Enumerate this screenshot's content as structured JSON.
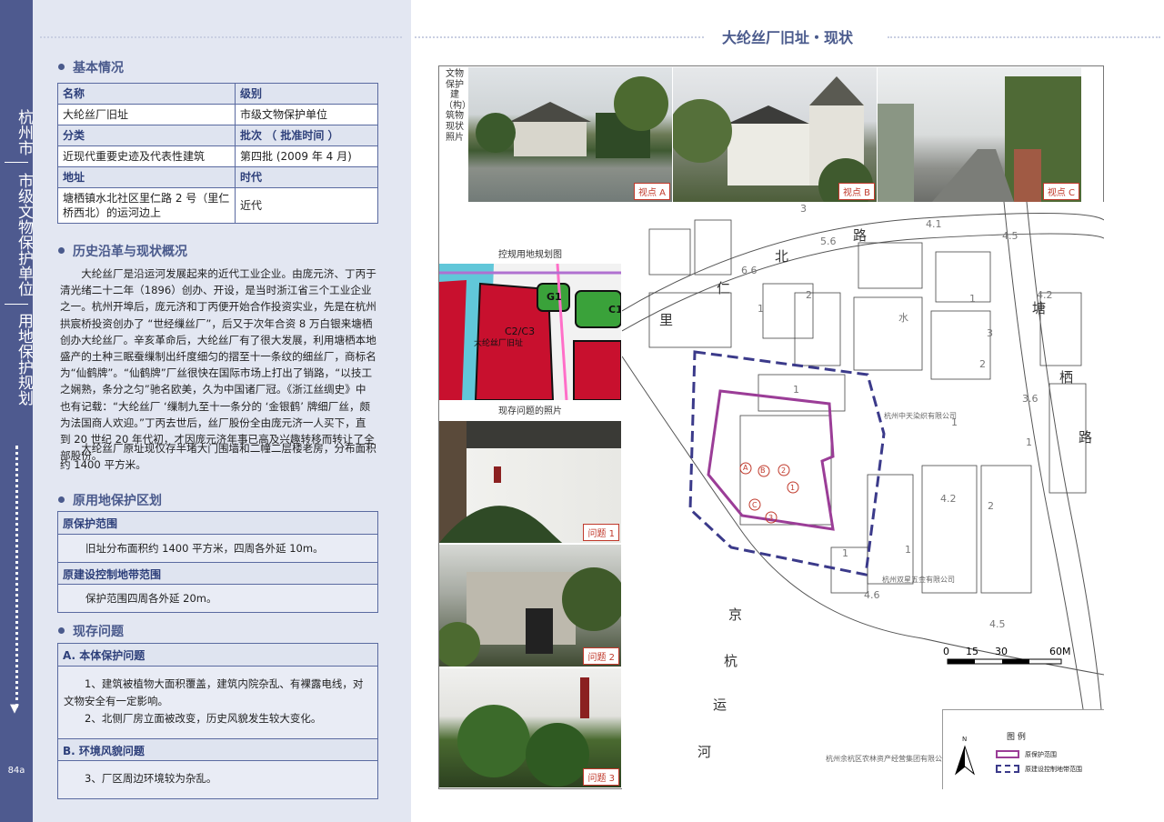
{
  "sidebar": {
    "city": "杭州市",
    "level": "市级文物保护单位",
    "plan": "用地保护规划",
    "page_no": "84a"
  },
  "page_title": "大纶丝厂旧址・现状",
  "sections": {
    "basic": "基本情况",
    "history": "历史沿革与现状概况",
    "protection": "原用地保护区划",
    "issues": "现存问题"
  },
  "basic_table": {
    "name_h": "名称",
    "name_v": "大纶丝厂旧址",
    "level_h": "级别",
    "level_v": "市级文物保护单位",
    "cat_h": "分类",
    "cat_v": "近现代重要史迹及代表性建筑",
    "batch_h": "批次 （ 批准时间 ）",
    "batch_v": "第四批 (2009 年 4 月)",
    "addr_h": "地址",
    "addr_v": "塘栖镇水北社区里仁路 2 号（里仁桥西北）的运河边上",
    "era_h": "时代",
    "era_v": "近代"
  },
  "history_text": "大纶丝厂是沿运河发展起来的近代工业企业。由庞元济、丁丙于清光绪二十二年（1896）创办、开设，是当时浙江省三个工业企业之一。杭州开埠后，庞元济和丁丙便开始合作投资实业，先是在杭州拱宸桥投资创办了 “世经缫丝厂”，后又于次年合资 8 万白银来塘栖创办大纶丝厂。辛亥革命后，大纶丝厂有了很大发展，利用塘栖本地盛产的土种三眠蚕缫制出纤度细匀的摺至十一条纹的细丝厂，商标名为“仙鹤牌”。“仙鹤牌”厂丝很快在国际市场上打出了销路，“以技工之娴熟，条分之匀”驰名欧美，久为中国诸厂冠。《浙江丝绸史》中也有记载：“大纶丝厂 ‘缫制九至十一条分的 ‘金银鹤’ 牌细厂丝，颇为法国商人欢迎。”丁丙去世后，丝厂股份全由庞元济一人买下，直到 20 世纪 20 年代初，才因庞元济年事已高及兴趣转移而转让了全部股份。",
  "history_text2": "大纶丝厂原址现仅存半堵大门围墙和二幢二层楼老房，分布面积约 1400 平方米。",
  "protection": {
    "range_h": "原保护范围",
    "range_v": "旧址分布面积约 1400 平方米，四周各外延 10m。",
    "ctrl_h": "原建设控制地带范围",
    "ctrl_v": "保护范围四周各外延 20m。"
  },
  "issues": {
    "a_h": "A. 本体保护问题",
    "a_v1": "1、建筑被植物大面积覆盖，建筑内院杂乱、有裸露电线，对文物安全有一定影响。",
    "a_v2": "2、北侧厂房立面被改变，历史风貌发生较大变化。",
    "b_h": "B. 环境风貌问题",
    "b_v": "3、厂区周边环境较为杂乱。"
  },
  "map": {
    "photo_caption": "文物保护建（构）筑物现状照片",
    "viewpoints": [
      "视点 A",
      "视点 B",
      "视点 C"
    ],
    "inset1_title": "控规用地规划图",
    "inset2_title": "现存问题的照片",
    "problems": [
      "问题 1",
      "问题 2",
      "问题 3"
    ],
    "landuse_labels": [
      "G1",
      "C1",
      "C2/C3",
      "大纶丝厂旧址"
    ],
    "road_north": [
      "里",
      "仁",
      "路",
      "北"
    ],
    "road_east": [
      "塘",
      "栖",
      "路"
    ],
    "river": [
      "京",
      "杭",
      "运",
      "河"
    ],
    "water_char": "水",
    "companies": [
      "杭州中天染织有限公司",
      "杭州双星五金有限公司",
      "杭州余杭区农林资产经营集团有限公司"
    ],
    "numbers": [
      "3",
      "4.1",
      "4.5",
      "5.6",
      "6.6",
      "2",
      "1",
      "3",
      "1",
      "2",
      "1",
      "1",
      "1",
      "4.2",
      "3.6",
      "4.2",
      "4.6",
      "4.5",
      "1",
      "1",
      "2",
      "1",
      "1",
      "1",
      "4.2",
      "1",
      "1",
      "2",
      "1",
      "1",
      "4.2"
    ],
    "scale": [
      "0",
      "15",
      "30",
      "60M"
    ],
    "markers": [
      "A",
      "B",
      "C",
      "1",
      "2",
      "3"
    ],
    "legend": {
      "title": "图   例",
      "item1": "原保护范围",
      "item2": "原建设控制地带范围",
      "north": "N"
    }
  }
}
